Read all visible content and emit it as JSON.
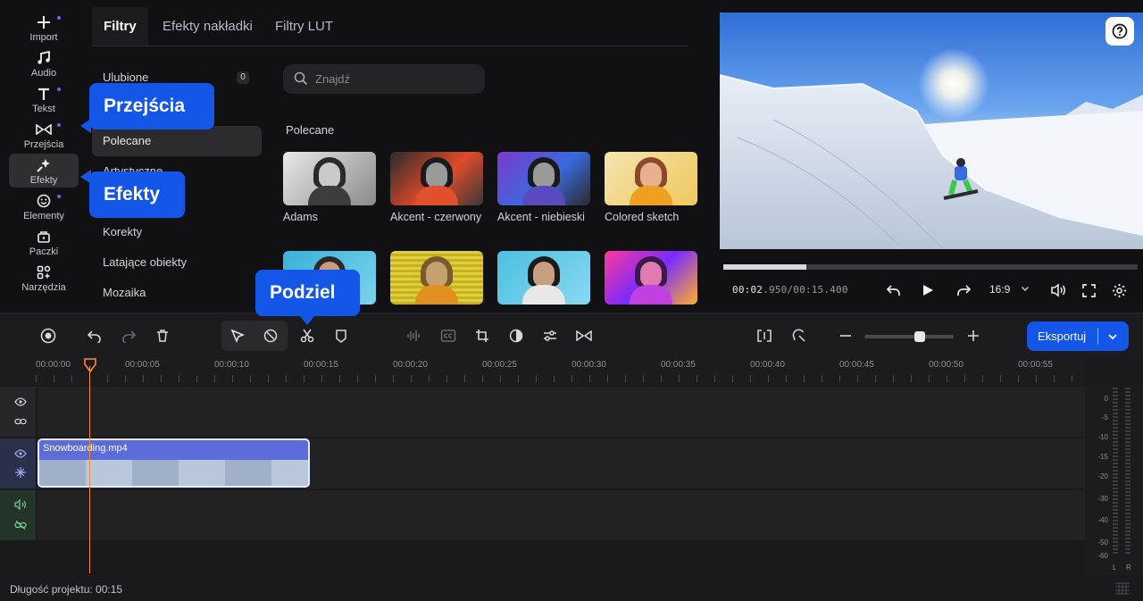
{
  "nav": {
    "items": [
      {
        "label": "Import",
        "icon": "plus-icon"
      },
      {
        "label": "Audio",
        "icon": "music-note-icon"
      },
      {
        "label": "Tekst",
        "icon": "text-icon"
      },
      {
        "label": "Przejścia",
        "icon": "transition-icon"
      },
      {
        "label": "Efekty",
        "icon": "sparkle-icon"
      },
      {
        "label": "Elementy",
        "icon": "smiley-icon"
      },
      {
        "label": "Paczki",
        "icon": "package-icon"
      },
      {
        "label": "Narzędzia",
        "icon": "tools-icon"
      }
    ],
    "active": "Efekty"
  },
  "panel": {
    "tabs": [
      "Filtry",
      "Efekty nakładki",
      "Filtry LUT"
    ],
    "active_tab": "Filtry",
    "categories": [
      {
        "label": "Ulubione",
        "count": "0"
      },
      {
        "label": "Polecane"
      },
      {
        "label": "Artystyczne"
      },
      {
        "label": "Korekty"
      },
      {
        "label": "Latające obiekty"
      },
      {
        "label": "Mozaika"
      }
    ],
    "active_category": "Polecane",
    "search_placeholder": "Znajdź",
    "section_title": "Polecane",
    "filters": [
      {
        "label": "Adams"
      },
      {
        "label": "Akcent - czerwony"
      },
      {
        "label": "Akcent - niebieski"
      },
      {
        "label": "Colored sketch"
      }
    ]
  },
  "callouts": {
    "transitions": "Przejścia",
    "effects": "Efekty",
    "split": "Podziel"
  },
  "preview": {
    "timecode_current_main": "00:02",
    "timecode_current_ms": ".950",
    "timecode_total": "/00:15.400",
    "progress": 0.2,
    "aspect_ratio": "16:9"
  },
  "toolbar": {
    "export_label": "Eksportuj",
    "zoom_level": 0.6
  },
  "timeline": {
    "ruler": [
      "00:00:00",
      "00:00:05",
      "00:00:10",
      "00:00:15",
      "00:00:20",
      "00:00:25",
      "00:00:30",
      "00:00:35",
      "00:00:40",
      "00:00:45",
      "00:00:50",
      "00:00:55"
    ],
    "clip_name": "Snowboarding.mp4",
    "meter_scale": [
      "0",
      "-5",
      "-10",
      "-15",
      "-20",
      "-30",
      "-40",
      "-50",
      "-60"
    ],
    "meter_channels": [
      "L",
      "R"
    ]
  },
  "status": {
    "project_length": "Długość projektu: 00:15"
  },
  "colors": {
    "accent": "#1456e8",
    "playhead": "#ff8a3c",
    "clip": "#5b6cdb",
    "nav_dot": "#7c5cff"
  }
}
